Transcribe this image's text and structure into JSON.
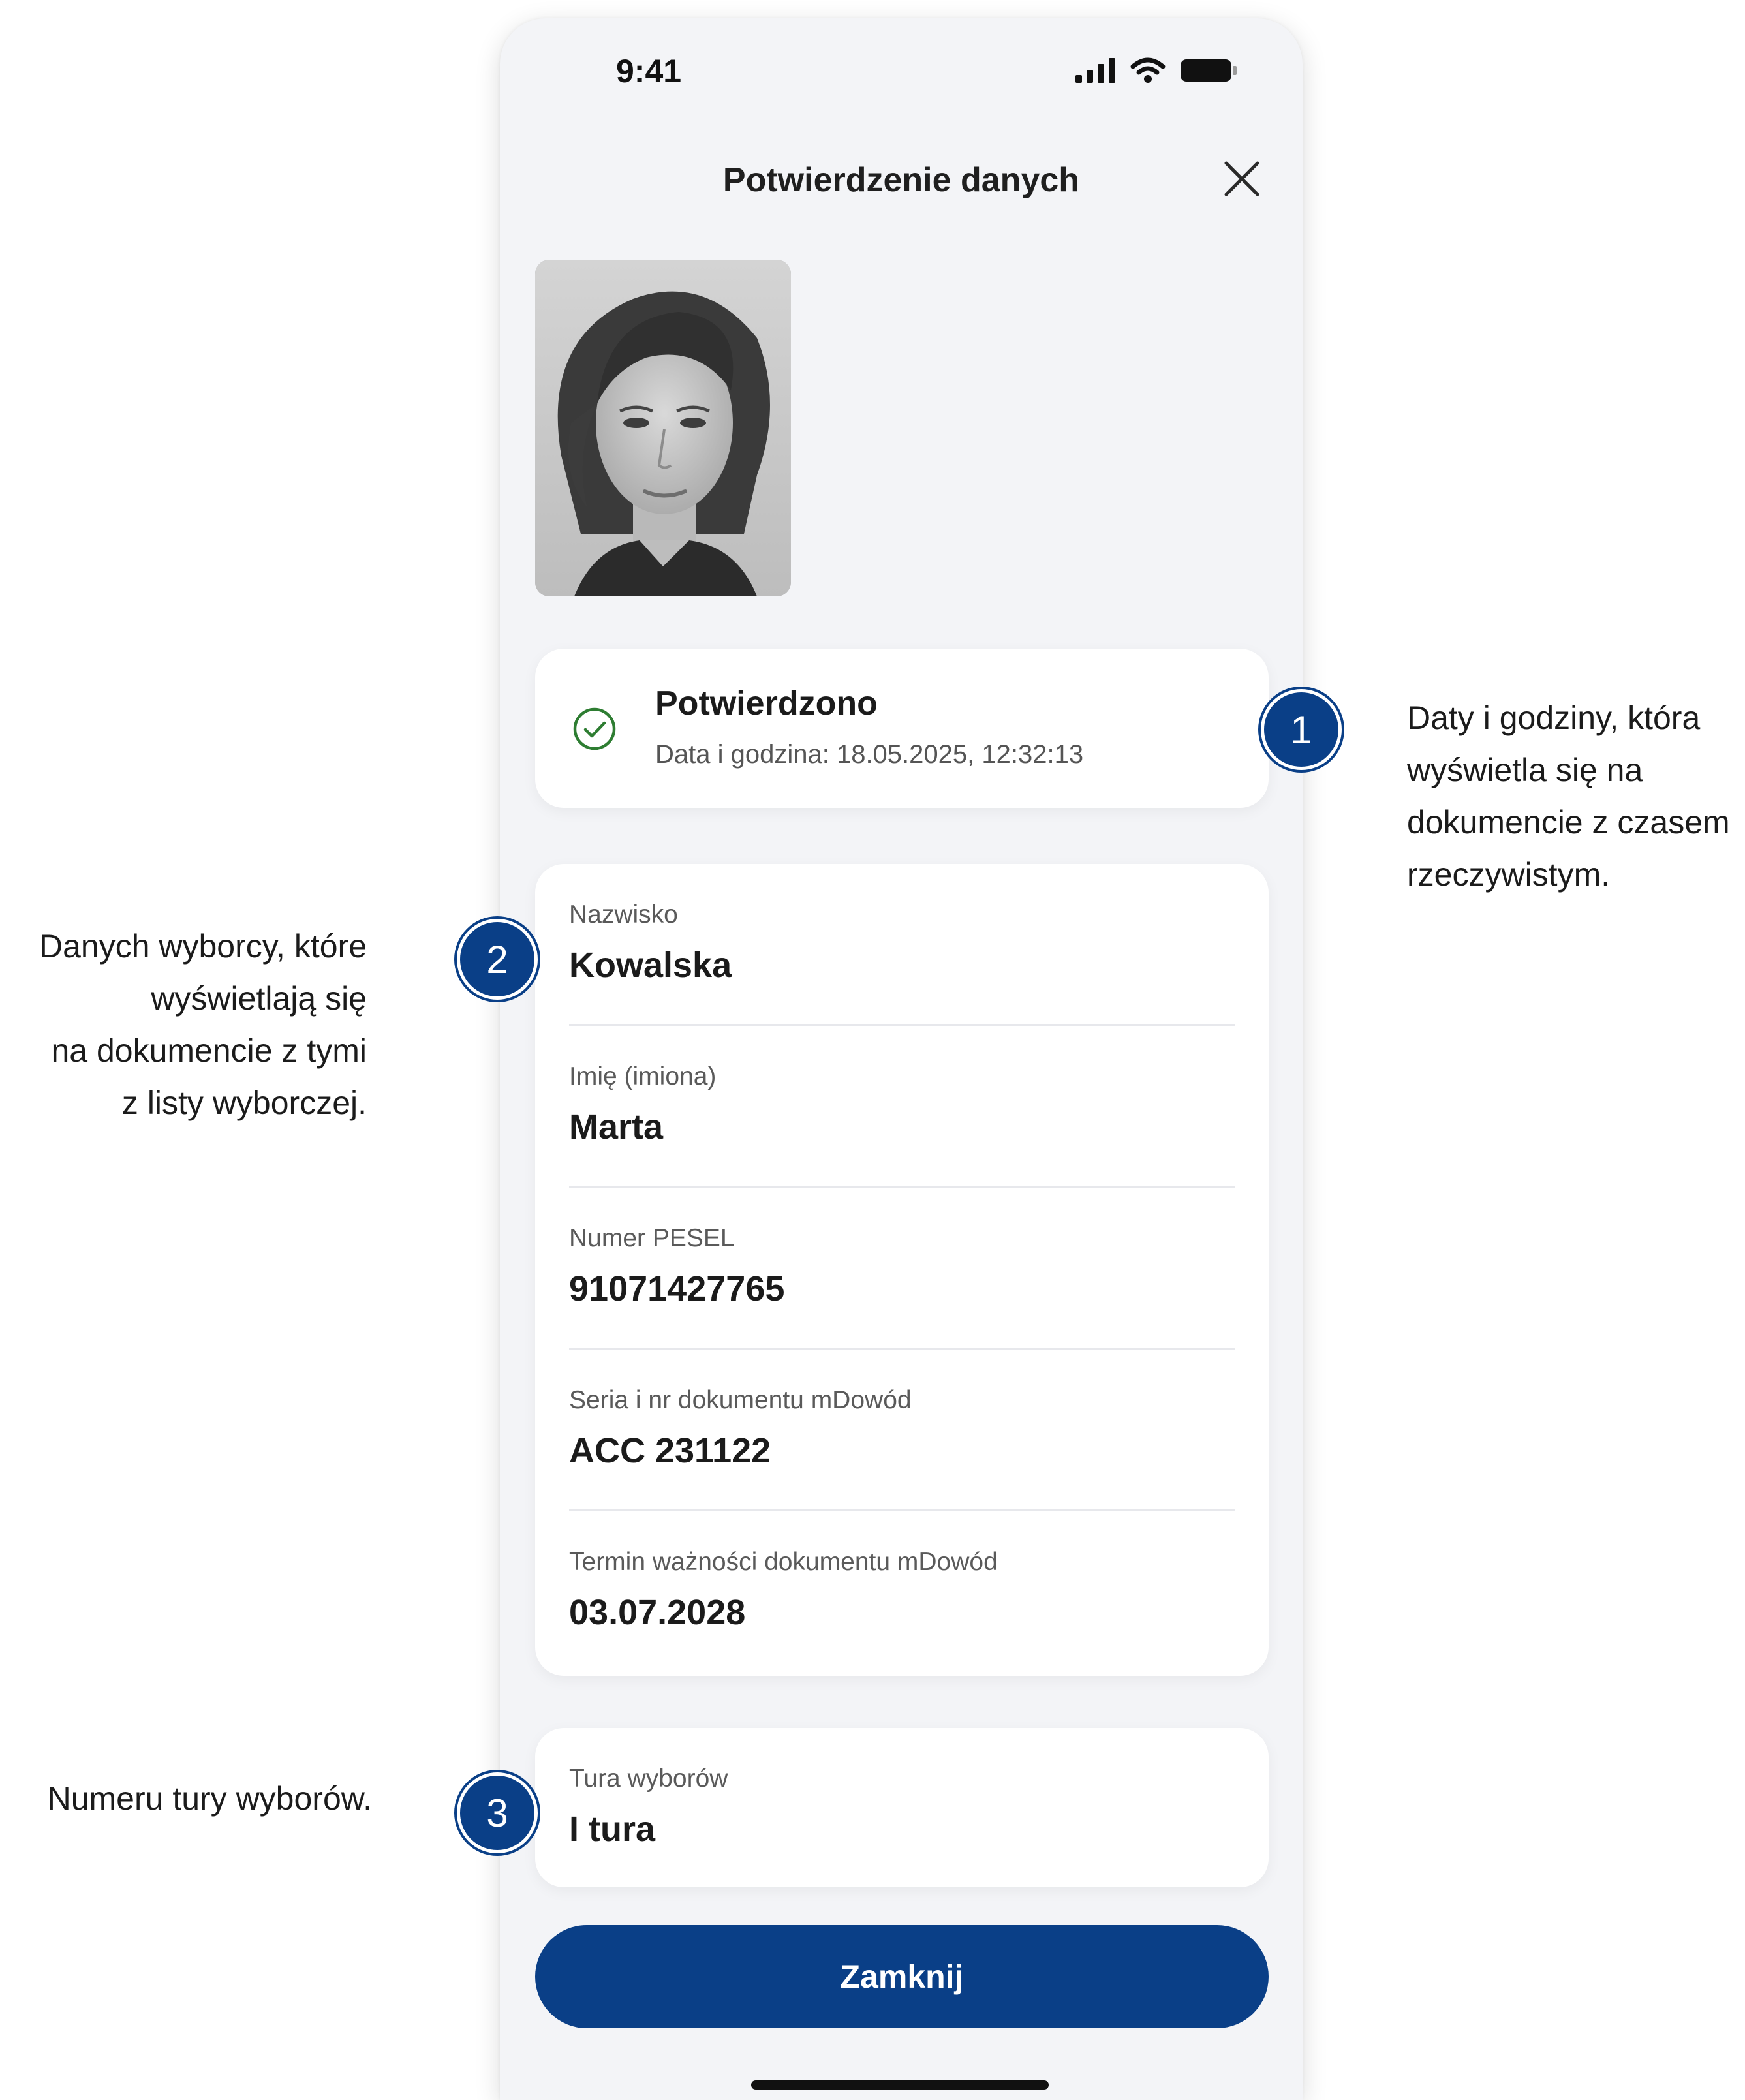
{
  "status_bar": {
    "time": "9:41",
    "icons": [
      "signal-icon",
      "wifi-icon",
      "battery-icon"
    ]
  },
  "header": {
    "title": "Potwierdzenie danych",
    "close_icon": "close-icon"
  },
  "confirmation": {
    "title": "Potwierdzono",
    "datetime": "Data i godzina: 18.05.2025, 12:32:13",
    "icon": "check-circle-icon",
    "icon_color": "#2e7d32"
  },
  "voter": {
    "rows": [
      {
        "label": "Nazwisko",
        "value": "Kowalska"
      },
      {
        "label": "Imię (imiona)",
        "value": "Marta"
      },
      {
        "label": "Numer PESEL",
        "value": "91071427765"
      },
      {
        "label": "Seria i nr dokumentu mDowód",
        "value": "ACC 231122"
      },
      {
        "label": "Termin ważności dokumentu mDowód",
        "value": "03.07.2028"
      }
    ]
  },
  "tour": {
    "label": "Tura wyborów",
    "value": "I tura"
  },
  "actions": {
    "close_label": "Zamknij"
  },
  "annotations": [
    {
      "number": "1",
      "lines": [
        "Daty i godziny, która",
        "wyświetla się na",
        "dokumencie z czasem",
        "rzeczywistym."
      ]
    },
    {
      "number": "2",
      "lines": [
        "Danych wyborcy, które",
        "wyświetlają się",
        "na dokumencie z tymi",
        "z listy wyborczej."
      ]
    },
    {
      "number": "3",
      "lines": [
        "Numeru tury wyborów."
      ]
    }
  ],
  "colors": {
    "accent": "#0a3f87",
    "screen_bg": "#f3f4f7",
    "card_bg": "#ffffff"
  }
}
